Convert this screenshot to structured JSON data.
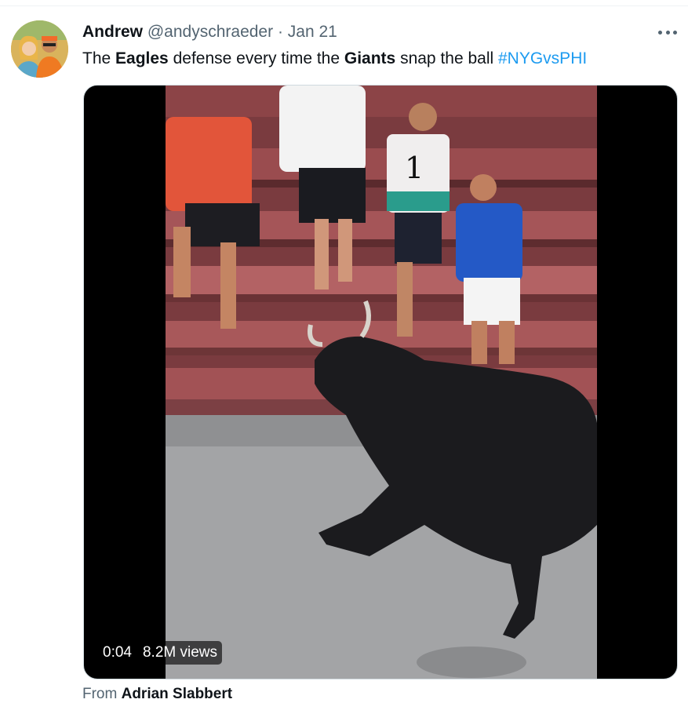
{
  "tweet": {
    "author_name": "Andrew",
    "handle": "@andyschraeder",
    "separator": "·",
    "date": "Jan 21",
    "text_parts": {
      "t1": "The ",
      "b1": "Eagles",
      "t2": " defense every time the ",
      "b2": "Giants",
      "t3": " snap the ball ",
      "hashtag": "#NYGvsPHI"
    },
    "more_icon": "more-horizontal-icon",
    "avatar_icon": "user-avatar-icon"
  },
  "video": {
    "time": "0:04",
    "views": "8.2M views"
  },
  "attribution": {
    "prefix": "From ",
    "source": "Adrian Slabbert"
  },
  "colors": {
    "accent": "#1d9bf0",
    "secondary_text": "#536471",
    "primary_text": "#0f1419"
  }
}
